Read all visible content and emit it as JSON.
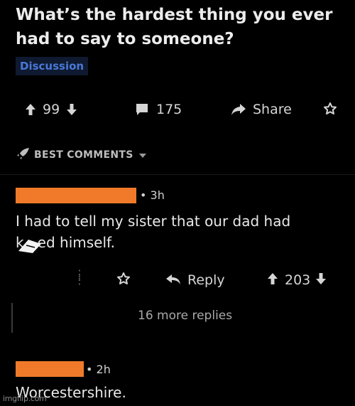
{
  "post": {
    "title": "What’s the hardest thing you ever had to say to someone?",
    "flair": "Discussion"
  },
  "post_actions": {
    "score": "99",
    "comment_count": "175",
    "share_label": "Share"
  },
  "sort": {
    "label": "BEST COMMENTS"
  },
  "comments": [
    {
      "age": "• 3h",
      "text_line1": "I had to tell my sister that our dad had",
      "text_line2": "k   ed himself.",
      "reply_label": "Reply",
      "score": "203",
      "more_replies": "16 more replies"
    },
    {
      "age": "• 2h",
      "text": "Worcestershire."
    }
  ],
  "watermark": "imgflip.com",
  "colors": {
    "background": "#000000",
    "text": "#e3e3e3",
    "flair_text": "#4a78d6",
    "redaction": "#f07a2a"
  },
  "icons": [
    "upvote-icon",
    "downvote-icon",
    "comment-icon",
    "share-icon",
    "star-icon",
    "rocket-icon",
    "chevron-down-icon",
    "reply-icon",
    "more-dots-icon"
  ]
}
